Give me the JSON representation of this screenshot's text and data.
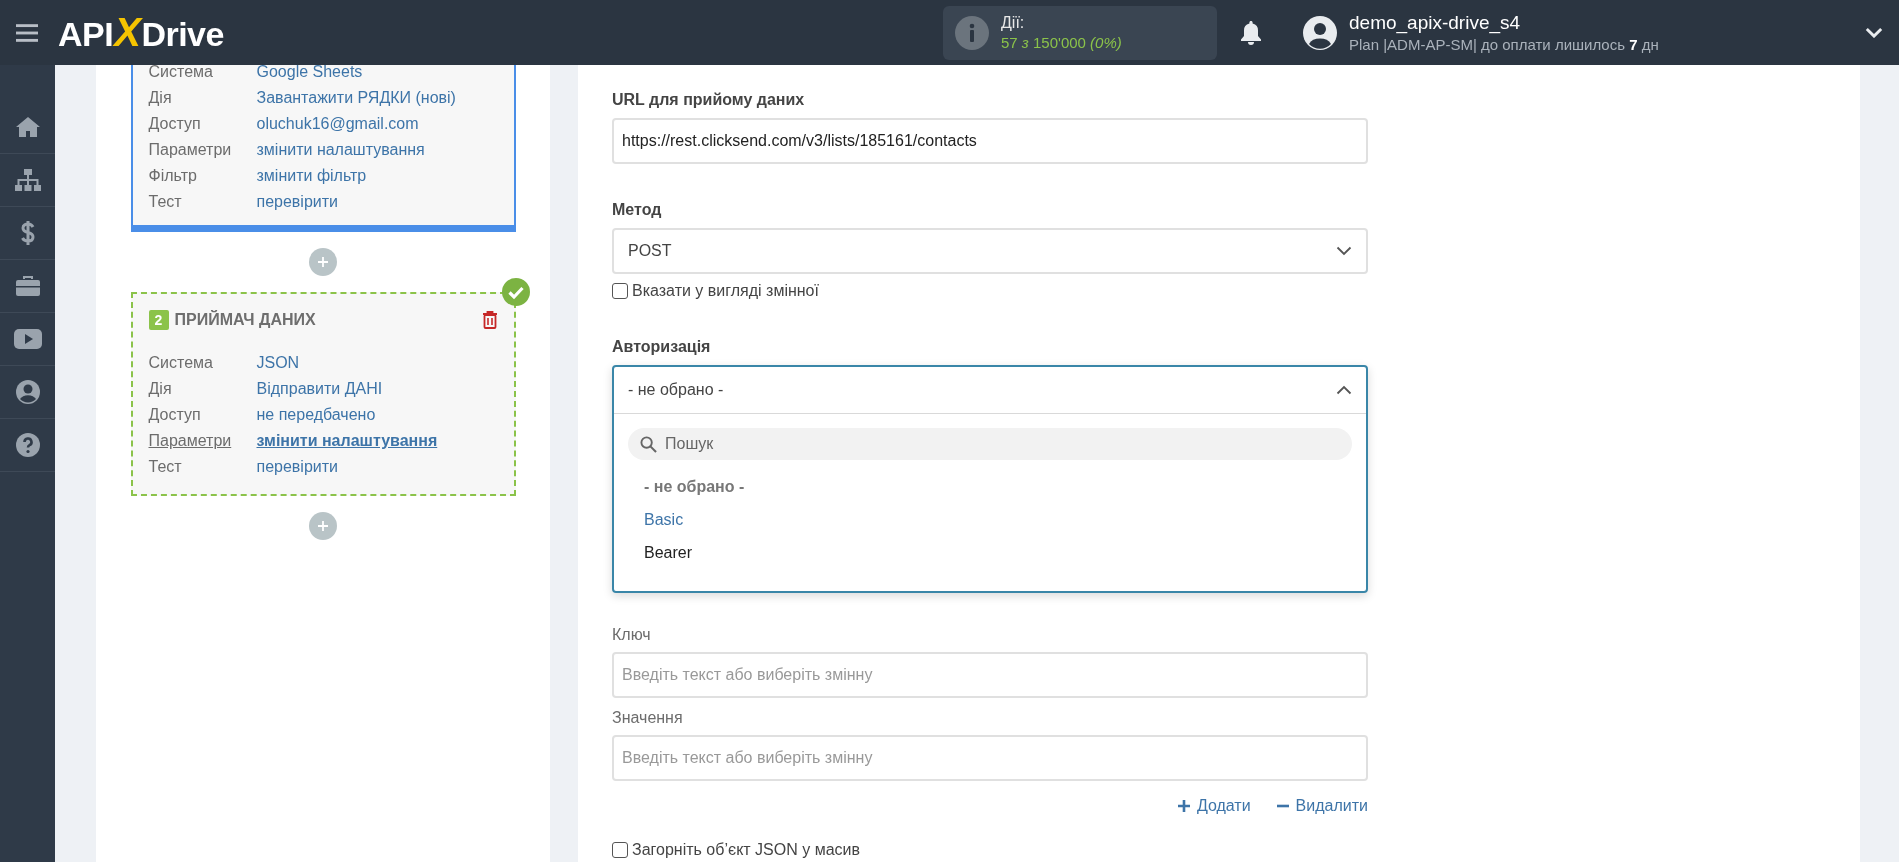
{
  "header": {
    "logo": [
      "API",
      "X",
      "Drive"
    ],
    "actions": {
      "label": "Дії:",
      "usage": "57 *з* 150'000 *(0%)*"
    },
    "user": {
      "name": "demo_apix-drive_s4",
      "plan": "Plan |ADM-AP-SM| до оплати лишилось **7** дн"
    }
  },
  "cards": [
    {
      "active": true,
      "rows": [
        {
          "label": "Система",
          "value": "Google Sheets",
          "selected": false
        },
        {
          "label": "Дія",
          "value": "Завантажити РЯДКИ (нові)",
          "selected": false
        },
        {
          "label": "Доступ",
          "value": "oluchuk16@gmail.com",
          "selected": false
        },
        {
          "label": "Параметри",
          "value": "змінити налаштування",
          "selected": false
        },
        {
          "label": "Фільтр",
          "value": "змінити фільтр",
          "selected": false
        },
        {
          "label": "Тест",
          "value": "перевірити",
          "selected": false
        }
      ]
    },
    {
      "active": false,
      "done": true,
      "number": "2",
      "title": "ПРИЙМАЧ ДАНИХ",
      "rows": [
        {
          "label": "Система",
          "value": "JSON",
          "selected": false
        },
        {
          "label": "Дія",
          "value": "Відправити ДАНІ",
          "selected": false
        },
        {
          "label": "Доступ",
          "value": "не передбачено",
          "selected": false
        },
        {
          "label": "Параметри",
          "value": "змінити налаштування",
          "selected": true
        },
        {
          "label": "Тест",
          "value": "перевірити",
          "selected": false
        }
      ]
    }
  ],
  "form": {
    "url": {
      "label": "URL для прийому даних",
      "value": "https://rest.clicksend.com/v3/lists/185161/contacts"
    },
    "method": {
      "label": "Метод",
      "value": "POST",
      "variable": {
        "label": "Вказати у вигляді змінної",
        "checked": false
      }
    },
    "auth": {
      "label": "Авторизація",
      "value": "- не обрано -",
      "expanded": true,
      "search": {
        "placeholder": "Пошук"
      },
      "options": [
        {
          "label": "- не обрано -",
          "selected": true,
          "highlighted": false
        },
        {
          "label": "Basic",
          "selected": false,
          "highlighted": true
        },
        {
          "label": "Bearer",
          "selected": false,
          "highlighted": false
        }
      ]
    },
    "key": {
      "label": "Ключ",
      "placeholder": "Введіть текст або виберіть змінну"
    },
    "value": {
      "label": "Значення",
      "placeholder": "Введіть текст або виберіть змінну"
    },
    "add": "Додати",
    "remove": "Видалити",
    "wrap": {
      "label": "Загорніть об’єкт JSON у масив",
      "checked": false
    }
  }
}
